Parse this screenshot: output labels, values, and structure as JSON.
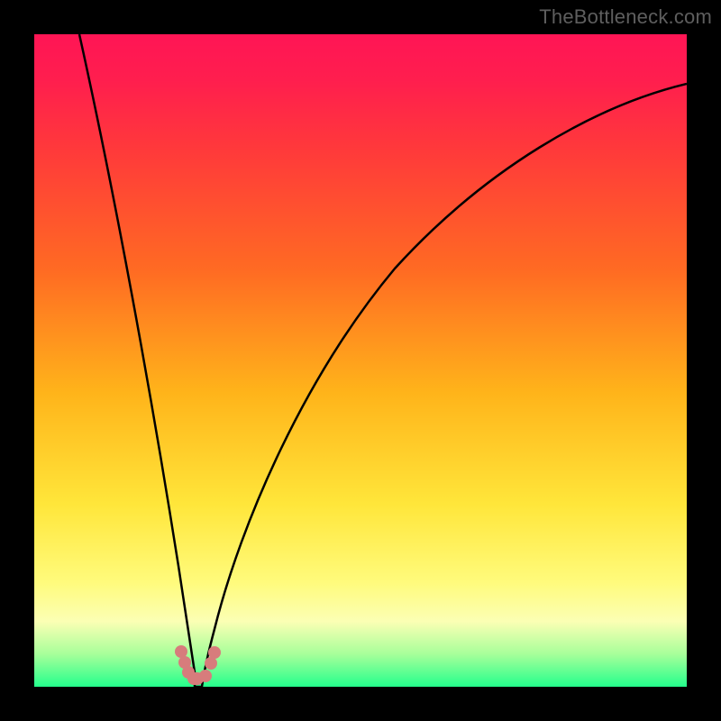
{
  "watermark": {
    "text": "TheBottleneck.com"
  },
  "chart_data": {
    "type": "line",
    "title": "",
    "xlabel": "",
    "ylabel": "",
    "xlim": [
      0,
      100
    ],
    "ylim": [
      0,
      100
    ],
    "grid": false,
    "legend": false,
    "background_gradient": {
      "direction": "vertical",
      "stops": [
        {
          "pos": 0,
          "color": "#ff1555"
        },
        {
          "pos": 18,
          "color": "#ff3a3a"
        },
        {
          "pos": 36,
          "color": "#ff6a23"
        },
        {
          "pos": 55,
          "color": "#ffb41a"
        },
        {
          "pos": 72,
          "color": "#ffe63a"
        },
        {
          "pos": 84,
          "color": "#fffb7c"
        },
        {
          "pos": 90,
          "color": "#fbffb4"
        },
        {
          "pos": 95,
          "color": "#a7ff9a"
        },
        {
          "pos": 100,
          "color": "#24ff8c"
        }
      ]
    },
    "series": [
      {
        "name": "bottleneck-curve",
        "color": "#000000",
        "x": [
          7,
          10,
          13,
          16,
          19,
          21,
          23,
          24.5,
          26,
          28,
          30,
          34,
          40,
          48,
          56,
          64,
          72,
          80,
          88,
          96,
          100
        ],
        "y": [
          100,
          82,
          64,
          46,
          28,
          15,
          6,
          1,
          2,
          8,
          16,
          30,
          45,
          58,
          67,
          74,
          79,
          83,
          86,
          89,
          90
        ]
      }
    ],
    "markers": [
      {
        "name": "highlight-points",
        "color": "#d77c7c",
        "shape": "rounded-blob",
        "points": [
          {
            "x": 22.5,
            "y": 5
          },
          {
            "x": 23.2,
            "y": 3
          },
          {
            "x": 24.0,
            "y": 1
          },
          {
            "x": 24.8,
            "y": 1
          },
          {
            "x": 26.5,
            "y": 3
          },
          {
            "x": 27.2,
            "y": 5
          }
        ]
      }
    ],
    "notch_at_min": {
      "x": 24.5,
      "y": 0
    }
  }
}
